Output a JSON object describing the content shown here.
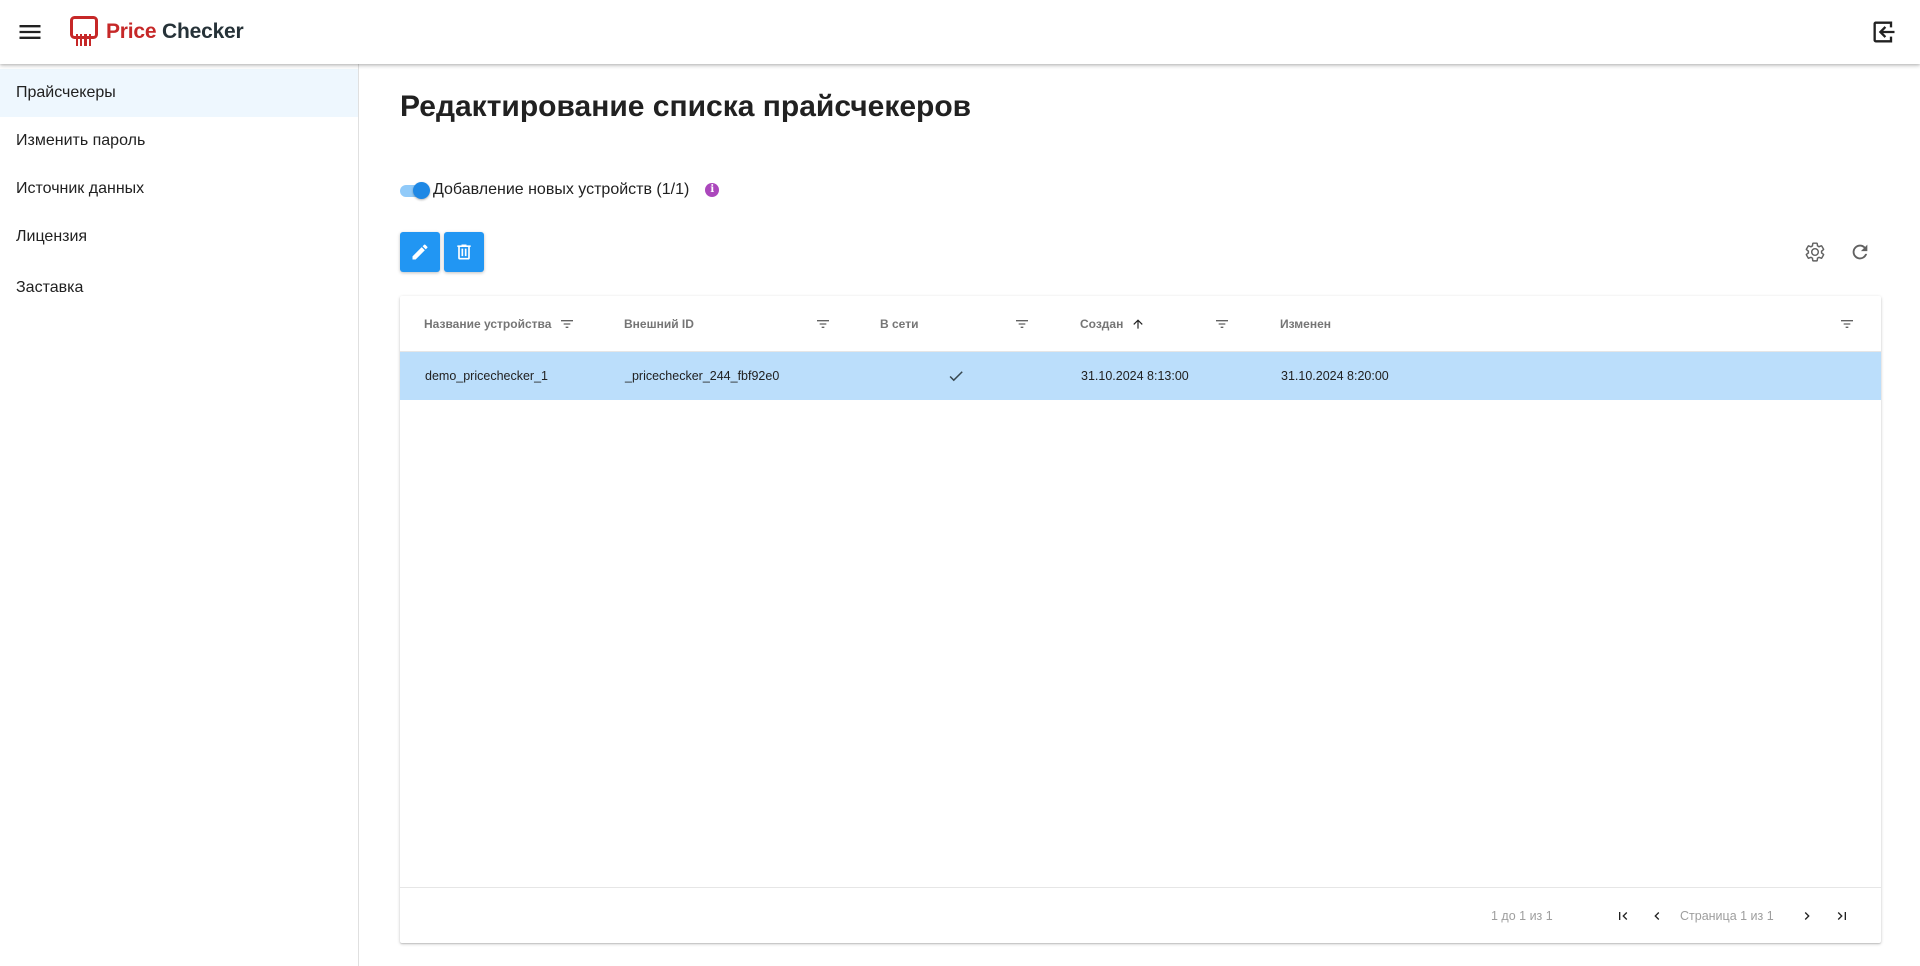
{
  "header": {
    "logo_word1": "Price",
    "logo_word2": "Checker"
  },
  "sidebar": {
    "items": [
      {
        "label": "Прайсчекеры",
        "active": true
      },
      {
        "label": "Изменить пароль",
        "active": false
      },
      {
        "label": "Источник данных",
        "active": false
      },
      {
        "label": "Лицензия",
        "active": false
      },
      {
        "label": "Заставка",
        "active": false
      }
    ]
  },
  "main": {
    "title": "Редактирование списка прайсчекеров",
    "toggle": {
      "label": "Добавление новых устройств (1/1)",
      "checked": true,
      "info_icon": "info-icon"
    }
  },
  "table": {
    "columns": [
      {
        "label": "Название устройства"
      },
      {
        "label": "Внешний ID"
      },
      {
        "label": "В сети"
      },
      {
        "label": "Создан",
        "sort": "ascending"
      },
      {
        "label": "Изменен"
      }
    ],
    "rows": [
      {
        "name": "demo_pricechecker_1",
        "external_id": "_pricechecker_244_fbf92e0",
        "online": true,
        "created": "31.10.2024 8:13:00",
        "modified": "31.10.2024 8:20:00"
      }
    ],
    "pagination": {
      "summary": "1 до 1 из 1",
      "page_label": "Страница 1 из 1"
    }
  },
  "colors": {
    "accent": "#2196f3",
    "selected_row": "#bbdefb",
    "active_nav": "#eef7fe",
    "brand_red": "#c62828",
    "info": "#ab47bc"
  }
}
